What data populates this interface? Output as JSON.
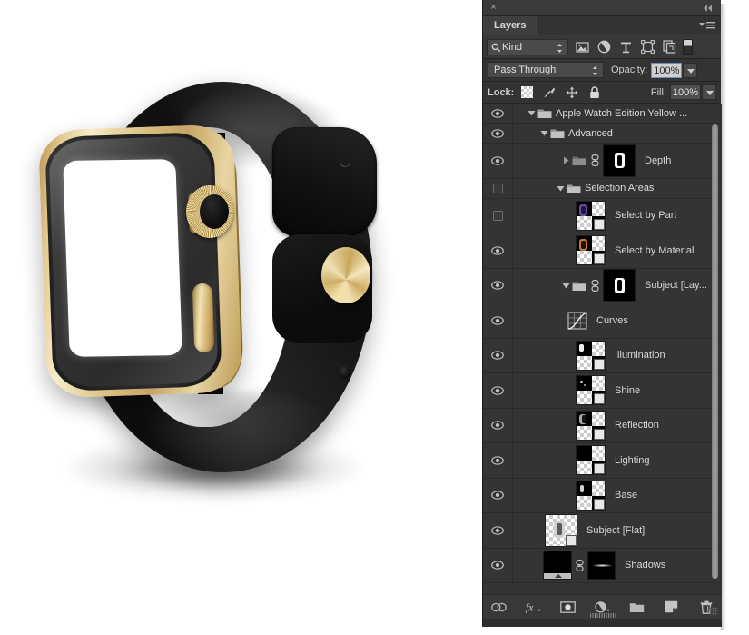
{
  "window": {
    "close_label": "×",
    "collapse_icon": "double-chevron-left-icon"
  },
  "panel": {
    "tab_label": "Layers",
    "menu_icon": "panel-menu-icon",
    "filter": {
      "search_icon": "search-icon",
      "kind_label": "Kind",
      "icons": [
        "pixel-layer-filter-icon",
        "adjustment-layer-filter-icon",
        "type-layer-filter-icon",
        "shape-layer-filter-icon",
        "smart-object-filter-icon"
      ],
      "toggle_name": "filter-enable-toggle"
    },
    "blend": {
      "mode": "Pass Through",
      "opacity_label": "Opacity:",
      "opacity_value": "100%"
    },
    "lock": {
      "label": "Lock:",
      "icons": [
        "lock-transparent-pixels-icon",
        "lock-image-pixels-icon",
        "lock-position-icon",
        "lock-all-icon"
      ],
      "fill_label": "Fill:",
      "fill_value": "100%"
    },
    "layers": [
      {
        "name": "Apple Watch Edition Yellow ...",
        "type": "group",
        "visible": true,
        "expanded": true,
        "indent": 0,
        "thumb": "none"
      },
      {
        "name": "Advanced",
        "type": "group",
        "visible": true,
        "expanded": true,
        "indent": 1,
        "thumb": "none"
      },
      {
        "name": "Depth",
        "type": "group-masked",
        "visible": true,
        "expanded": false,
        "indent": 2,
        "thumb": "mask-watch",
        "linked": true
      },
      {
        "name": "Selection Areas",
        "type": "group",
        "visible": false,
        "expanded": true,
        "indent": 2,
        "thumb": "none"
      },
      {
        "name": "Select by Part",
        "type": "layer",
        "visible": false,
        "indent": 3,
        "thumb": "layer-purple"
      },
      {
        "name": "Select by Material",
        "type": "layer",
        "visible": true,
        "indent": 3,
        "thumb": "layer-orange"
      },
      {
        "name": "Subject [Lay...",
        "type": "group-masked",
        "visible": true,
        "expanded": true,
        "indent": 2,
        "thumb": "mask-watch",
        "linked": true
      },
      {
        "name": "Curves",
        "type": "adjustment",
        "visible": true,
        "indent": 3,
        "thumb": "curves"
      },
      {
        "name": "Illumination",
        "type": "layer",
        "visible": true,
        "indent": 3,
        "thumb": "layer-dark"
      },
      {
        "name": "Shine",
        "type": "layer",
        "visible": true,
        "indent": 3,
        "thumb": "layer-dark"
      },
      {
        "name": "Reflection",
        "type": "layer",
        "visible": true,
        "indent": 3,
        "thumb": "layer-dark"
      },
      {
        "name": "Lighting",
        "type": "layer",
        "visible": true,
        "indent": 3,
        "thumb": "layer-black"
      },
      {
        "name": "Base",
        "type": "layer",
        "visible": true,
        "indent": 3,
        "thumb": "layer-dark"
      },
      {
        "name": "Subject [Flat]",
        "type": "layer",
        "visible": true,
        "indent": 2,
        "thumb": "flat-watch"
      },
      {
        "name": "Shadows",
        "type": "layer-masked",
        "visible": true,
        "indent": 2,
        "thumb": "shadows",
        "linked": true
      }
    ],
    "bottom_toolbar": [
      "link-layers-icon",
      "layer-effects-fx-icon",
      "add-layer-mask-icon",
      "new-adjustment-layer-icon",
      "new-group-icon",
      "new-layer-icon",
      "delete-layer-icon"
    ]
  },
  "canvas": {
    "subject": "Apple Watch Edition Yellow Gold with black sport band",
    "background_color": "#ffffff",
    "case_color": "#d9bc7d",
    "band_color": "#0d0d0d",
    "screen_color": "#ffffff"
  }
}
